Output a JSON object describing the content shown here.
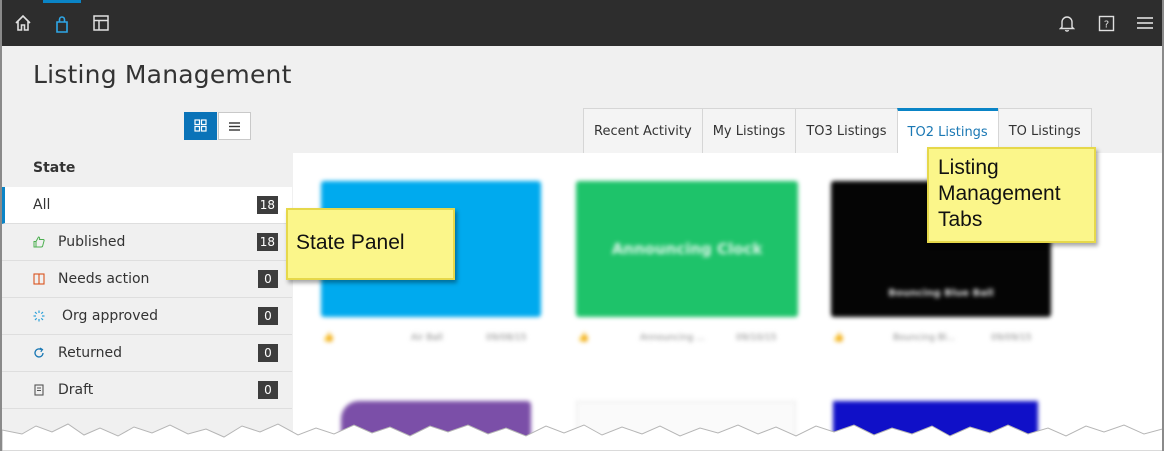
{
  "topbar": {
    "left_icons": [
      "home-icon",
      "bag-icon",
      "layout-icon"
    ],
    "right_icons": [
      "bell-icon",
      "help-icon",
      "menu-icon"
    ]
  },
  "page": {
    "title": "Listing Management"
  },
  "view_toggle": {
    "options": [
      "grid-view-icon",
      "list-view-icon"
    ],
    "selected": "grid-view-icon"
  },
  "tabs": [
    {
      "label": "Recent Activity"
    },
    {
      "label": "My Listings"
    },
    {
      "label": "TO3 Listings"
    },
    {
      "label": "TO2 Listings"
    },
    {
      "label": "TO Listings"
    }
  ],
  "active_tab": "TO2 Listings",
  "state_panel": {
    "header": "State",
    "items": [
      {
        "label": "All",
        "count": "18",
        "icon": ""
      },
      {
        "label": "Published",
        "count": "18",
        "icon": "thumbs-up-icon"
      },
      {
        "label": "Needs action",
        "count": "0",
        "icon": "book-icon"
      },
      {
        "label": "Org approved",
        "count": "0",
        "icon": "spinner-icon"
      },
      {
        "label": "Returned",
        "count": "0",
        "icon": "refresh-icon"
      },
      {
        "label": "Draft",
        "count": "0",
        "icon": "document-icon"
      }
    ]
  },
  "cards": [
    {
      "title": "",
      "meta_name": "Air Ball",
      "meta_date": "09/08/15",
      "color": "#00aaee"
    },
    {
      "title": "Announcing Clock",
      "meta_name": "Announcing ...",
      "meta_date": "09/10/15",
      "color": "#1ec36a"
    },
    {
      "title": "Bouncing Blue Ball",
      "meta_name": "Bouncing Bl...",
      "meta_date": "09/09/15",
      "color": "#050505"
    }
  ],
  "callouts": {
    "state_panel": "State Panel",
    "tabs": "Listing Management Tabs"
  },
  "colors": {
    "accent": "#0a84c6",
    "topbar": "#2d2d2d",
    "callout": "#fbf68a"
  }
}
